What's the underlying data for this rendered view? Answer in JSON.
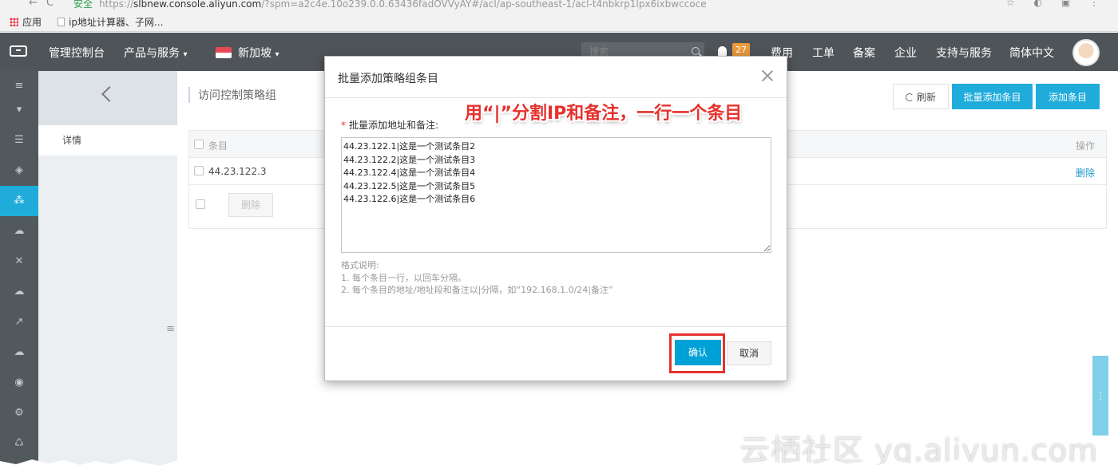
{
  "browser": {
    "secure_label": "安全",
    "url_prefix": "https://",
    "url_host": "slbnew.console.aliyun.com",
    "url_rest": "/?spm=a2c4e.10o239.0.0.63436fadOVVyAY#/acl/ap-southeast-1/acl-t4nbkrp1lpx6ixbwccoce",
    "bookmarks": [
      "应用",
      "ip地址计算器、子网..."
    ]
  },
  "topnav": {
    "console_label": "管理控制台",
    "products_label": "产品与服务",
    "region_label": "新加坡",
    "search_placeholder": "搜索",
    "notification_count": "27",
    "items": [
      "费用",
      "工单",
      "备案",
      "企业",
      "支持与服务",
      "简体中文"
    ]
  },
  "subsidebar": {
    "item_detail": "详情"
  },
  "main": {
    "page_title": "访问控制策略组",
    "refresh_label": "刷新",
    "bulk_add_label": "批量添加条目",
    "add_label": "添加条目",
    "table": {
      "col_entry": "条目",
      "col_action": "操作",
      "rows": [
        {
          "entry": "44.23.122.3",
          "action": "删除"
        }
      ]
    },
    "delete_label": "删除"
  },
  "modal": {
    "title": "批量添加策略组条目",
    "field_label": "批量添加地址和备注:",
    "textarea_value": "44.23.122.1|这是一个测试条目2\n44.23.122.2|这是一个测试条目3\n44.23.122.4|这是一个测试条目4\n44.23.122.5|这是一个测试条目5\n44.23.122.6|这是一个测试条目6",
    "note_title": "格式说明:",
    "note_line1": "1. 每个条目一行，以回车分隔。",
    "note_line2": "2. 每个条目的地址/地址段和备注以|分隔，如“192.168.1.0/24|备注”",
    "confirm_label": "确认",
    "cancel_label": "取消"
  },
  "annotation_text": "用“|”分割IP和备注，一行一个条目",
  "watermark": "云栖社区 yq.aliyun.com",
  "colors": {
    "accent": "#00a1d6",
    "topnav_bg": "#373d41",
    "highlight_red": "#e5322d"
  }
}
